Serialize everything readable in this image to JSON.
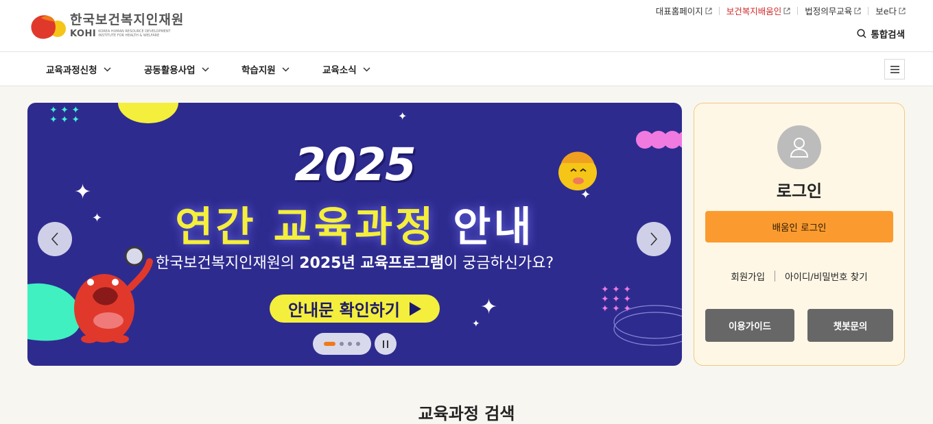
{
  "header": {
    "logo_kr": "한국보건복지인재원",
    "logo_en": "KOHI",
    "logo_sub": "KOREA HUMAN RESOURCE DEVELOPMENT INSTITUTE FOR HEALTH & WELFARE",
    "util_links": [
      "대표홈페이지",
      "보건복지배움인",
      "법정의무교육",
      "보e다"
    ],
    "search_label": "통합검색"
  },
  "gnb": {
    "items": [
      "교육과정신청",
      "공동활용사업",
      "학습지원",
      "교육소식"
    ]
  },
  "banner": {
    "year": "2025",
    "headline_a": "연간",
    "headline_b": "교육과정",
    "headline_c": "안내",
    "sub_a": "한국보건복지인재원의 ",
    "sub_b": "2025년 교육프로그램",
    "sub_c": "이 궁금하신가요?",
    "cta_label": "안내문 확인하기",
    "slide_count": 4,
    "active_slide": 1
  },
  "login": {
    "title": "로그인",
    "login_button": "배움인 로그인",
    "signup": "회원가입",
    "find": "아이디/비밀번호 찾기",
    "guide_button": "이용가이드",
    "chatbot_button": "챗봇문의"
  },
  "section": {
    "title": "교육과정 검색"
  },
  "colors": {
    "banner_bg": "#2e2b8f",
    "headline_yellow": "#f4ef3c",
    "login_orange": "#fb9b2f",
    "accent_red": "#d02a2a"
  }
}
